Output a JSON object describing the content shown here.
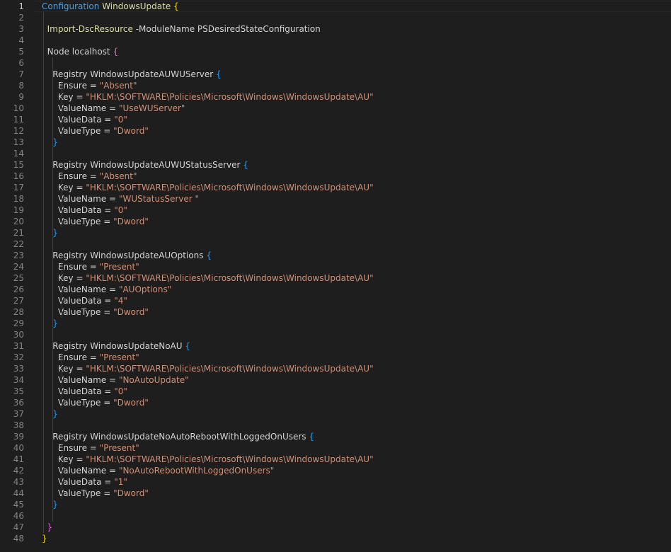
{
  "editor": {
    "lines": [
      {
        "num": "1",
        "tokens": [
          {
            "t": "Configuration",
            "c": "kw"
          },
          {
            "t": " WindowsUpdate ",
            "c": "ident"
          },
          {
            "t": "{",
            "c": "br1"
          }
        ]
      },
      {
        "num": "2",
        "tokens": []
      },
      {
        "num": "3",
        "tokens": [
          {
            "t": "  Import-DscResource",
            "c": "ident"
          },
          {
            "t": " -ModuleName PSDesiredStateConfiguration",
            "c": "plain"
          }
        ]
      },
      {
        "num": "4",
        "tokens": []
      },
      {
        "num": "5",
        "tokens": [
          {
            "t": "  Node localhost ",
            "c": "plain"
          },
          {
            "t": "{",
            "c": "br2"
          }
        ]
      },
      {
        "num": "6",
        "tokens": []
      },
      {
        "num": "7",
        "tokens": [
          {
            "t": "    Registry WindowsUpdateAUWUServer ",
            "c": "plain"
          },
          {
            "t": "{",
            "c": "br3"
          }
        ]
      },
      {
        "num": "8",
        "tokens": [
          {
            "t": "      Ensure = ",
            "c": "plain"
          },
          {
            "t": "\"Absent\"",
            "c": "str"
          }
        ]
      },
      {
        "num": "9",
        "tokens": [
          {
            "t": "      Key = ",
            "c": "plain"
          },
          {
            "t": "\"HKLM:\\SOFTWARE\\Policies\\Microsoft\\Windows\\WindowsUpdate\\AU\"",
            "c": "str"
          }
        ]
      },
      {
        "num": "10",
        "tokens": [
          {
            "t": "      ValueName = ",
            "c": "plain"
          },
          {
            "t": "\"UseWUServer\"",
            "c": "str"
          }
        ]
      },
      {
        "num": "11",
        "tokens": [
          {
            "t": "      ValueData = ",
            "c": "plain"
          },
          {
            "t": "\"0\"",
            "c": "str"
          }
        ]
      },
      {
        "num": "12",
        "tokens": [
          {
            "t": "      ValueType = ",
            "c": "plain"
          },
          {
            "t": "\"Dword\"",
            "c": "str"
          }
        ]
      },
      {
        "num": "13",
        "tokens": [
          {
            "t": "    ",
            "c": "plain"
          },
          {
            "t": "}",
            "c": "br3"
          }
        ]
      },
      {
        "num": "14",
        "tokens": []
      },
      {
        "num": "15",
        "tokens": [
          {
            "t": "    Registry WindowsUpdateAUWUStatusServer ",
            "c": "plain"
          },
          {
            "t": "{",
            "c": "br3"
          }
        ]
      },
      {
        "num": "16",
        "tokens": [
          {
            "t": "      Ensure = ",
            "c": "plain"
          },
          {
            "t": "\"Absent\"",
            "c": "str"
          }
        ]
      },
      {
        "num": "17",
        "tokens": [
          {
            "t": "      Key = ",
            "c": "plain"
          },
          {
            "t": "\"HKLM:\\SOFTWARE\\Policies\\Microsoft\\Windows\\WindowsUpdate\\AU\"",
            "c": "str"
          }
        ]
      },
      {
        "num": "18",
        "tokens": [
          {
            "t": "      ValueName = ",
            "c": "plain"
          },
          {
            "t": "\"WUStatusServer \"",
            "c": "str"
          }
        ]
      },
      {
        "num": "19",
        "tokens": [
          {
            "t": "      ValueData = ",
            "c": "plain"
          },
          {
            "t": "\"0\"",
            "c": "str"
          }
        ]
      },
      {
        "num": "20",
        "tokens": [
          {
            "t": "      ValueType = ",
            "c": "plain"
          },
          {
            "t": "\"Dword\"",
            "c": "str"
          }
        ]
      },
      {
        "num": "21",
        "tokens": [
          {
            "t": "    ",
            "c": "plain"
          },
          {
            "t": "}",
            "c": "br3"
          }
        ]
      },
      {
        "num": "22",
        "tokens": []
      },
      {
        "num": "23",
        "tokens": [
          {
            "t": "    Registry WindowsUpdateAUOptions ",
            "c": "plain"
          },
          {
            "t": "{",
            "c": "br3"
          }
        ]
      },
      {
        "num": "24",
        "tokens": [
          {
            "t": "      Ensure = ",
            "c": "plain"
          },
          {
            "t": "\"Present\"",
            "c": "str"
          }
        ]
      },
      {
        "num": "25",
        "tokens": [
          {
            "t": "      Key = ",
            "c": "plain"
          },
          {
            "t": "\"HKLM:\\SOFTWARE\\Policies\\Microsoft\\Windows\\WindowsUpdate\\AU\"",
            "c": "str"
          }
        ]
      },
      {
        "num": "26",
        "tokens": [
          {
            "t": "      ValueName = ",
            "c": "plain"
          },
          {
            "t": "\"AUOptions\"",
            "c": "str"
          }
        ]
      },
      {
        "num": "27",
        "tokens": [
          {
            "t": "      ValueData = ",
            "c": "plain"
          },
          {
            "t": "\"4\"",
            "c": "str"
          }
        ]
      },
      {
        "num": "28",
        "tokens": [
          {
            "t": "      ValueType = ",
            "c": "plain"
          },
          {
            "t": "\"Dword\"",
            "c": "str"
          }
        ]
      },
      {
        "num": "29",
        "tokens": [
          {
            "t": "    ",
            "c": "plain"
          },
          {
            "t": "}",
            "c": "br3"
          }
        ]
      },
      {
        "num": "30",
        "tokens": []
      },
      {
        "num": "31",
        "tokens": [
          {
            "t": "    Registry WindowsUpdateNoAU ",
            "c": "plain"
          },
          {
            "t": "{",
            "c": "br3"
          }
        ]
      },
      {
        "num": "32",
        "tokens": [
          {
            "t": "      Ensure = ",
            "c": "plain"
          },
          {
            "t": "\"Present\"",
            "c": "str"
          }
        ]
      },
      {
        "num": "33",
        "tokens": [
          {
            "t": "      Key = ",
            "c": "plain"
          },
          {
            "t": "\"HKLM:\\SOFTWARE\\Policies\\Microsoft\\Windows\\WindowsUpdate\\AU\"",
            "c": "str"
          }
        ]
      },
      {
        "num": "34",
        "tokens": [
          {
            "t": "      ValueName = ",
            "c": "plain"
          },
          {
            "t": "\"NoAutoUpdate\"",
            "c": "str"
          }
        ]
      },
      {
        "num": "35",
        "tokens": [
          {
            "t": "      ValueData = ",
            "c": "plain"
          },
          {
            "t": "\"0\"",
            "c": "str"
          }
        ]
      },
      {
        "num": "36",
        "tokens": [
          {
            "t": "      ValueType = ",
            "c": "plain"
          },
          {
            "t": "\"Dword\"",
            "c": "str"
          }
        ]
      },
      {
        "num": "37",
        "tokens": [
          {
            "t": "    ",
            "c": "plain"
          },
          {
            "t": "}",
            "c": "br3"
          }
        ]
      },
      {
        "num": "38",
        "tokens": []
      },
      {
        "num": "39",
        "tokens": [
          {
            "t": "    Registry WindowsUpdateNoAutoRebootWithLoggedOnUsers ",
            "c": "plain"
          },
          {
            "t": "{",
            "c": "br3"
          }
        ]
      },
      {
        "num": "40",
        "tokens": [
          {
            "t": "      Ensure = ",
            "c": "plain"
          },
          {
            "t": "\"Present\"",
            "c": "str"
          }
        ]
      },
      {
        "num": "41",
        "tokens": [
          {
            "t": "      Key = ",
            "c": "plain"
          },
          {
            "t": "\"HKLM:\\SOFTWARE\\Policies\\Microsoft\\Windows\\WindowsUpdate\\AU\"",
            "c": "str"
          }
        ]
      },
      {
        "num": "42",
        "tokens": [
          {
            "t": "      ValueName = ",
            "c": "plain"
          },
          {
            "t": "\"NoAutoRebootWithLoggedOnUsers\"",
            "c": "str"
          }
        ]
      },
      {
        "num": "43",
        "tokens": [
          {
            "t": "      ValueData = ",
            "c": "plain"
          },
          {
            "t": "\"1\"",
            "c": "str"
          }
        ]
      },
      {
        "num": "44",
        "tokens": [
          {
            "t": "      ValueType = ",
            "c": "plain"
          },
          {
            "t": "\"Dword\"",
            "c": "str"
          }
        ]
      },
      {
        "num": "45",
        "tokens": [
          {
            "t": "    ",
            "c": "plain"
          },
          {
            "t": "}",
            "c": "br3"
          }
        ]
      },
      {
        "num": "46",
        "tokens": []
      },
      {
        "num": "47",
        "tokens": [
          {
            "t": "  ",
            "c": "plain"
          },
          {
            "t": "}",
            "c": "br2"
          }
        ]
      },
      {
        "num": "48",
        "tokens": [
          {
            "t": "}",
            "c": "br1"
          }
        ]
      }
    ],
    "active_line": "1"
  },
  "colors": {
    "background": "#1e1e1e",
    "keyword": "#569cd6",
    "function": "#dcdcaa",
    "string": "#ce9178",
    "text": "#d4d4d4",
    "bracket_level1": "#ffd700",
    "bracket_level2": "#da70d6",
    "bracket_level3": "#179fff",
    "line_number": "#858585"
  }
}
